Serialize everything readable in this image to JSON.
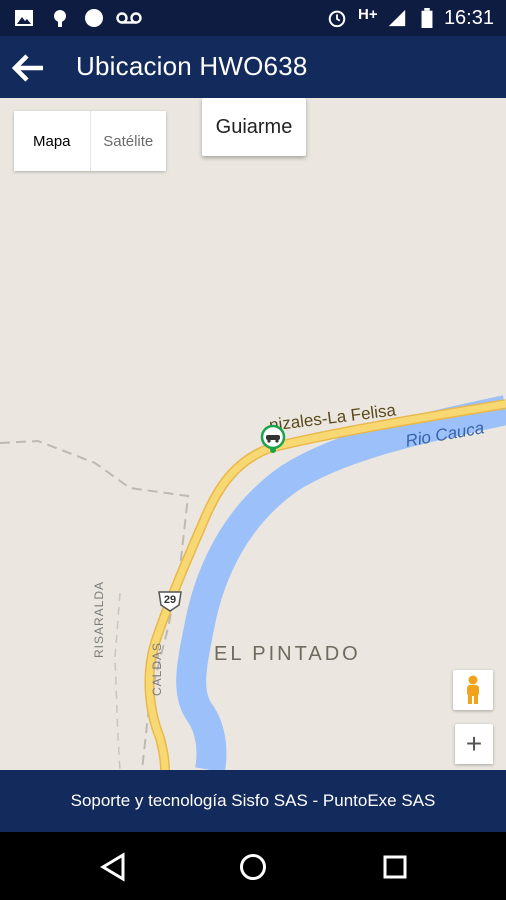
{
  "status_bar": {
    "time": "16:31",
    "network": "H+",
    "icons": [
      "image-icon",
      "android-icon",
      "dots-icon",
      "voicemail-icon",
      "alarm-icon",
      "signal-icon",
      "battery-icon"
    ]
  },
  "app_bar": {
    "title": "Ubicacion HWO638",
    "back_icon": "arrow-back-icon"
  },
  "map": {
    "type_options": [
      {
        "label": "Mapa",
        "selected": true
      },
      {
        "label": "Satélite",
        "selected": false
      }
    ],
    "guide_button": "Guiarme",
    "labels": {
      "place": "EL PINTADO",
      "road": "nizales-La Felisa",
      "river": "Rio Cauca",
      "region_left": "RISARALDA",
      "region_right": "CALDAS",
      "route_number": "29"
    },
    "controls": {
      "pegman_icon": "street-view-pegman-icon",
      "zoom_in": "+"
    },
    "marker_icon": "vehicle-location-icon"
  },
  "footer": {
    "text": "Soporte y tecnología Sisfo SAS - PuntoExe SAS"
  },
  "nav_bar": {
    "icons": [
      "back-triangle-icon",
      "home-circle-icon",
      "recents-square-icon"
    ]
  },
  "colors": {
    "header": "#132a5c",
    "map_bg": "#ebe7e0",
    "road": "#f4cf63",
    "river": "#9cc0f9",
    "marker": "#1aa34a"
  }
}
